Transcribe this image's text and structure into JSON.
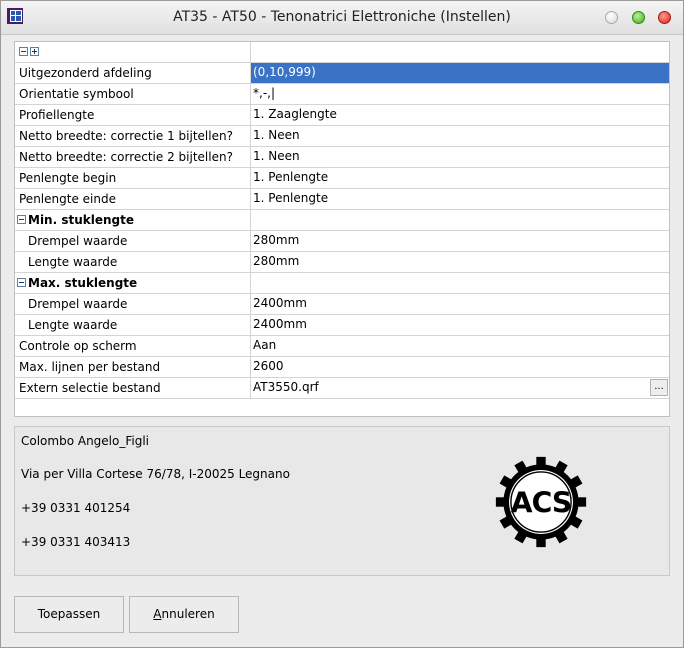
{
  "window": {
    "title": "AT35 - AT50 - Tenonatrici Elettroniche (Instellen)"
  },
  "grid": {
    "rows": [
      {
        "name": "Uitgezonderd afdeling",
        "value": "(0,10,999)",
        "selected": true
      },
      {
        "name": "Orientatie symbool",
        "value": "*,-,|"
      },
      {
        "name": "Profiellengte",
        "value": "1. Zaaglengte"
      },
      {
        "name": "Netto breedte: correctie 1 bijtellen?",
        "value": "1. Neen"
      },
      {
        "name": "Netto breedte: correctie 2 bijtellen?",
        "value": "1. Neen"
      },
      {
        "name": "Penlengte begin",
        "value": "1. Penlengte"
      },
      {
        "name": "Penlengte einde",
        "value": "1. Penlengte"
      },
      {
        "name": "Min. stuklengte",
        "value": "",
        "category": true
      },
      {
        "name": "Drempel waarde",
        "value": "280mm",
        "indent": true
      },
      {
        "name": "Lengte waarde",
        "value": "280mm",
        "indent": true
      },
      {
        "name": "Max. stuklengte",
        "value": "",
        "category": true
      },
      {
        "name": "Drempel waarde",
        "value": "2400mm",
        "indent": true
      },
      {
        "name": "Lengte waarde",
        "value": "2400mm",
        "indent": true
      },
      {
        "name": "Controle op scherm",
        "value": "Aan"
      },
      {
        "name": "Max. lijnen per bestand",
        "value": "2600"
      },
      {
        "name": "Extern selectie bestand",
        "value": "AT3550.qrf",
        "ellipsis": "..."
      }
    ]
  },
  "info": {
    "company": "Colombo Angelo_Figli",
    "address": "Via per Villa Cortese 76/78, I-20025 Legnano",
    "phone1": "+39 0331 401254",
    "phone2": "+39 0331 403413",
    "logo_text": "ACS"
  },
  "buttons": {
    "apply": "Toepassen",
    "cancel_first": "A",
    "cancel_rest": "nnuleren"
  },
  "colors": {
    "selection": "#3a73c6",
    "close": "#d9251a",
    "maximize": "#3fae1a"
  }
}
